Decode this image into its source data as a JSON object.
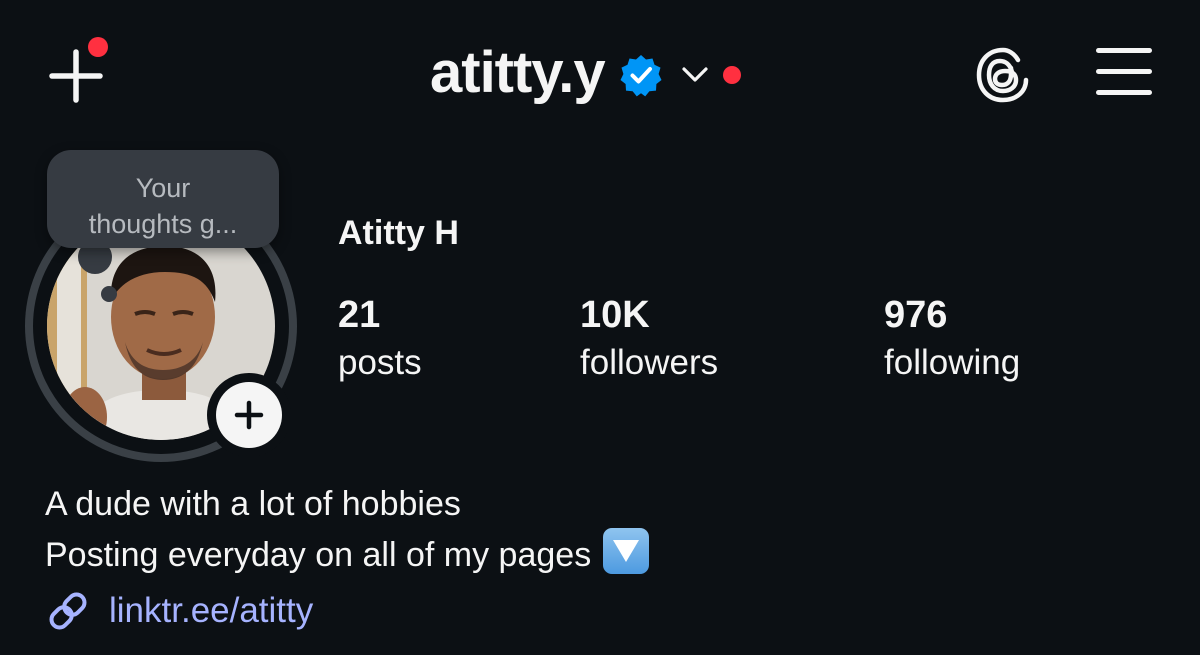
{
  "header": {
    "username": "atitty.y",
    "verified": true,
    "has_notification_dot": true,
    "icons": {
      "new_post": "plus-icon",
      "verified": "verified-badge-icon",
      "switch_account": "chevron-down-icon",
      "threads": "threads-icon",
      "menu": "hamburger-menu-icon"
    }
  },
  "note": {
    "text": "Your\nthoughts g..."
  },
  "profile": {
    "display_name": "Atitty H",
    "stats": {
      "posts": {
        "count": "21",
        "label": "posts"
      },
      "followers": {
        "count": "10K",
        "label": "followers"
      },
      "following": {
        "count": "976",
        "label": "following"
      }
    }
  },
  "bio": {
    "lines": [
      "A dude with a lot of hobbies",
      "Posting everyday on all of my pages"
    ],
    "emoji": "down-arrow-button-emoji",
    "link": "linktr.ee/atitty"
  },
  "colors": {
    "background": "#0c1014",
    "text": "#f5f5f5",
    "notification_red": "#ff3040",
    "verified_blue": "#0095f6",
    "link": "#a6b3ff",
    "note_bubble": "#363b42"
  }
}
